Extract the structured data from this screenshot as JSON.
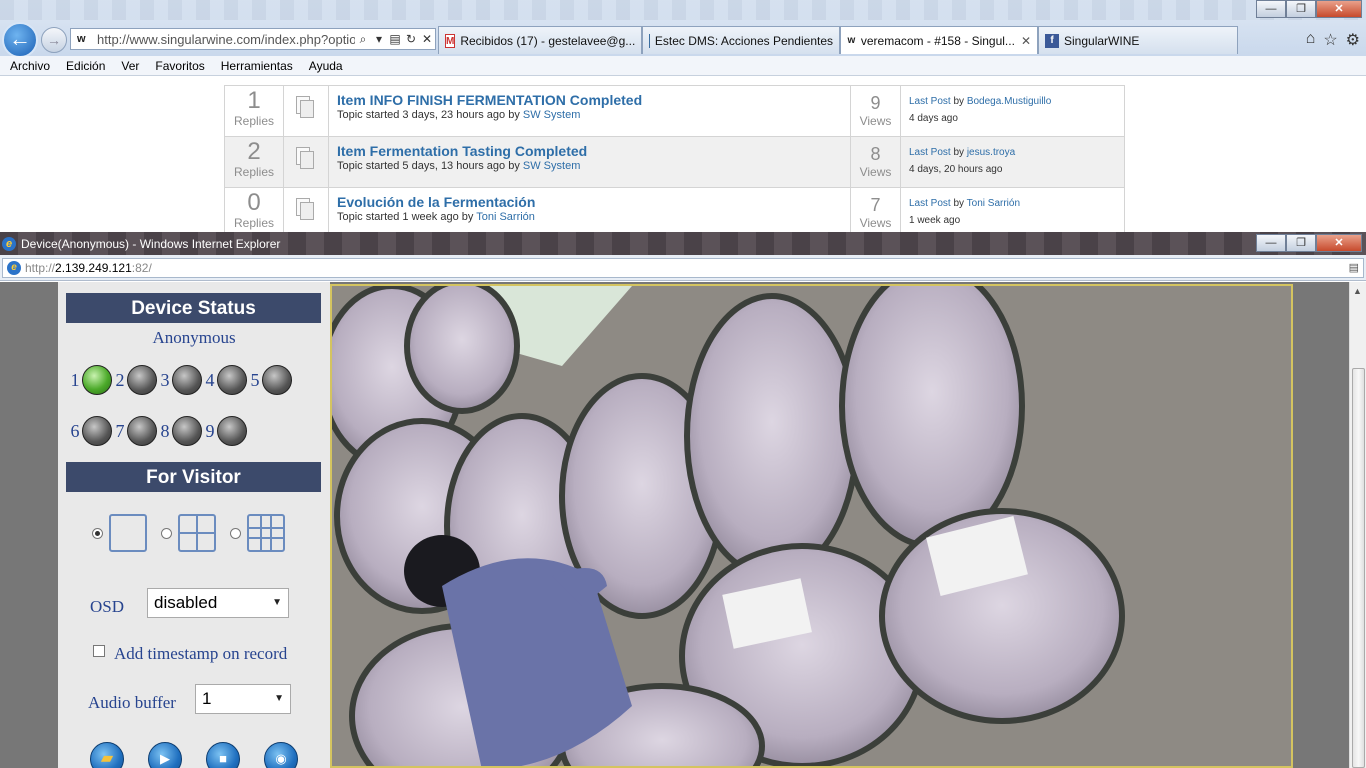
{
  "browser": {
    "url": "http://www.singularwine.com/index.php?optior",
    "tabs": [
      {
        "label": "Recibidos (17) - gestelavee@g...",
        "icon": "gmail-icon",
        "active": false
      },
      {
        "label": "Estec DMS: Acciones Pendientes",
        "icon": "estec-icon",
        "active": false
      },
      {
        "label": "veremacom - #158 - Singul...",
        "icon": "singularwine-icon",
        "active": true
      },
      {
        "label": "SingularWINE",
        "icon": "facebook-icon",
        "active": false
      }
    ],
    "menu": [
      "Archivo",
      "Edición",
      "Ver",
      "Favoritos",
      "Herramientas",
      "Ayuda"
    ]
  },
  "forum": {
    "rows": [
      {
        "replies": "1",
        "replies_label": "Replies",
        "title": "Item INFO FINISH FERMENTATION Completed",
        "started": "Topic started 3 days, 23 hours ago by",
        "author": "SW System",
        "views": "9",
        "views_label": "Views",
        "last_post": "Last Post",
        "by": "by",
        "last_author": "Bodega.Mustiguillo",
        "last_date": "4 days ago"
      },
      {
        "replies": "2",
        "replies_label": "Replies",
        "title": "Item Fermentation Tasting Completed",
        "started": "Topic started 5 days, 13 hours ago by",
        "author": "SW System",
        "views": "8",
        "views_label": "Views",
        "last_post": "Last Post",
        "by": "by",
        "last_author": "jesus.troya",
        "last_date": "4 days, 20 hours ago"
      },
      {
        "replies": "0",
        "replies_label": "Replies",
        "title": "Evolución de la Fermentación",
        "started": "Topic started 1 week ago by",
        "author": "Toni Sarrión",
        "views": "7",
        "views_label": "Views",
        "last_post": "Last Post",
        "by": "by",
        "last_author": "Toni Sarrión",
        "last_date": "1 week ago"
      }
    ]
  },
  "popup": {
    "title": "Device(Anonymous) - Windows Internet Explorer",
    "url_prefix": "http://",
    "url_host": "2.139.249.121",
    "url_suffix": ":82/"
  },
  "device": {
    "status_header": "Device Status",
    "user": "Anonymous",
    "channels": [
      {
        "num": "1",
        "on": true
      },
      {
        "num": "2",
        "on": false
      },
      {
        "num": "3",
        "on": false
      },
      {
        "num": "4",
        "on": false
      },
      {
        "num": "5",
        "on": false
      },
      {
        "num": "6",
        "on": false
      },
      {
        "num": "7",
        "on": false
      },
      {
        "num": "8",
        "on": false
      },
      {
        "num": "9",
        "on": false
      }
    ],
    "visitor_header": "For Visitor",
    "osd_label": "OSD",
    "osd_value": "disabled",
    "timestamp_label": "Add timestamp on record",
    "audio_label": "Audio buffer",
    "audio_value": "1"
  },
  "colors": {
    "header_bg": "#3c4a6b",
    "link": "#2e6ea8",
    "led_on": "#4caa2a"
  }
}
